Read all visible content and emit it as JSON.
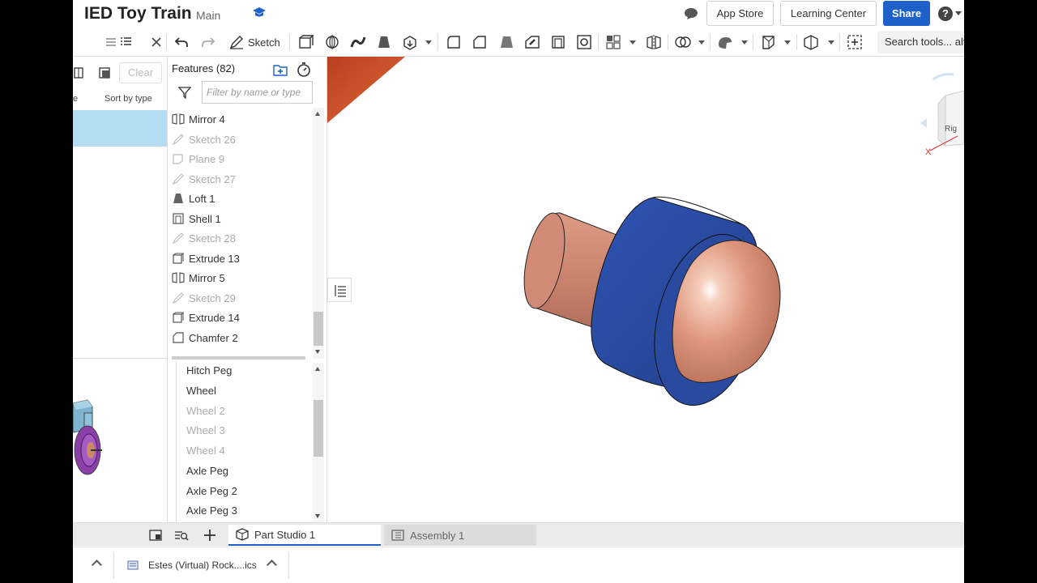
{
  "header": {
    "title": "IED Toy Train",
    "branch": "Main",
    "app_store": "App Store",
    "learning_center": "Learning Center",
    "share": "Share",
    "help": "?"
  },
  "toolbar": {
    "sketch_label": "Sketch",
    "search_placeholder": "Search tools... alt+c"
  },
  "left_panel": {
    "clear_label": "Clear",
    "sort_label": "Sort by type",
    "col_fragment": "e"
  },
  "features": {
    "title": "Features (82)",
    "filter_placeholder": "Filter by name or type",
    "items": [
      {
        "label": "Mirror 4",
        "icon": "mirror-icon",
        "dim": false
      },
      {
        "label": "Sketch 26",
        "icon": "sketch-icon",
        "dim": true
      },
      {
        "label": "Plane 9",
        "icon": "plane-icon",
        "dim": true
      },
      {
        "label": "Sketch 27",
        "icon": "sketch-icon",
        "dim": true
      },
      {
        "label": "Loft 1",
        "icon": "loft-icon",
        "dim": false
      },
      {
        "label": "Shell 1",
        "icon": "shell-icon",
        "dim": false
      },
      {
        "label": "Sketch 28",
        "icon": "sketch-icon",
        "dim": true
      },
      {
        "label": "Extrude 13",
        "icon": "extrude-icon",
        "dim": false
      },
      {
        "label": "Mirror 5",
        "icon": "mirror-icon",
        "dim": false
      },
      {
        "label": "Sketch 29",
        "icon": "sketch-icon",
        "dim": true
      },
      {
        "label": "Extrude 14",
        "icon": "extrude-icon",
        "dim": false
      },
      {
        "label": "Chamfer 2",
        "icon": "chamfer-icon",
        "dim": false
      }
    ]
  },
  "parts": {
    "items": [
      {
        "label": "Hitch Peg",
        "dim": false
      },
      {
        "label": "Wheel",
        "dim": false
      },
      {
        "label": "Wheel 2",
        "dim": true
      },
      {
        "label": "Wheel 3",
        "dim": true
      },
      {
        "label": "Wheel 4",
        "dim": true
      },
      {
        "label": "Axle Peg",
        "dim": false
      },
      {
        "label": "Axle Peg 2",
        "dim": false
      },
      {
        "label": "Axle Peg 3",
        "dim": false
      }
    ]
  },
  "tabs": {
    "part_studio": "Part Studio 1",
    "assembly": "Assembly 1"
  },
  "viewcube": {
    "x_axis": "X",
    "face_label": "Rig"
  },
  "downloads": {
    "file_name": "Estes (Virtual) Rock....ics"
  },
  "colors": {
    "accent": "#1d61c9",
    "selection": "#b4dcf3",
    "part_copper": "#d98f78",
    "part_blue": "#2a4fa8"
  }
}
